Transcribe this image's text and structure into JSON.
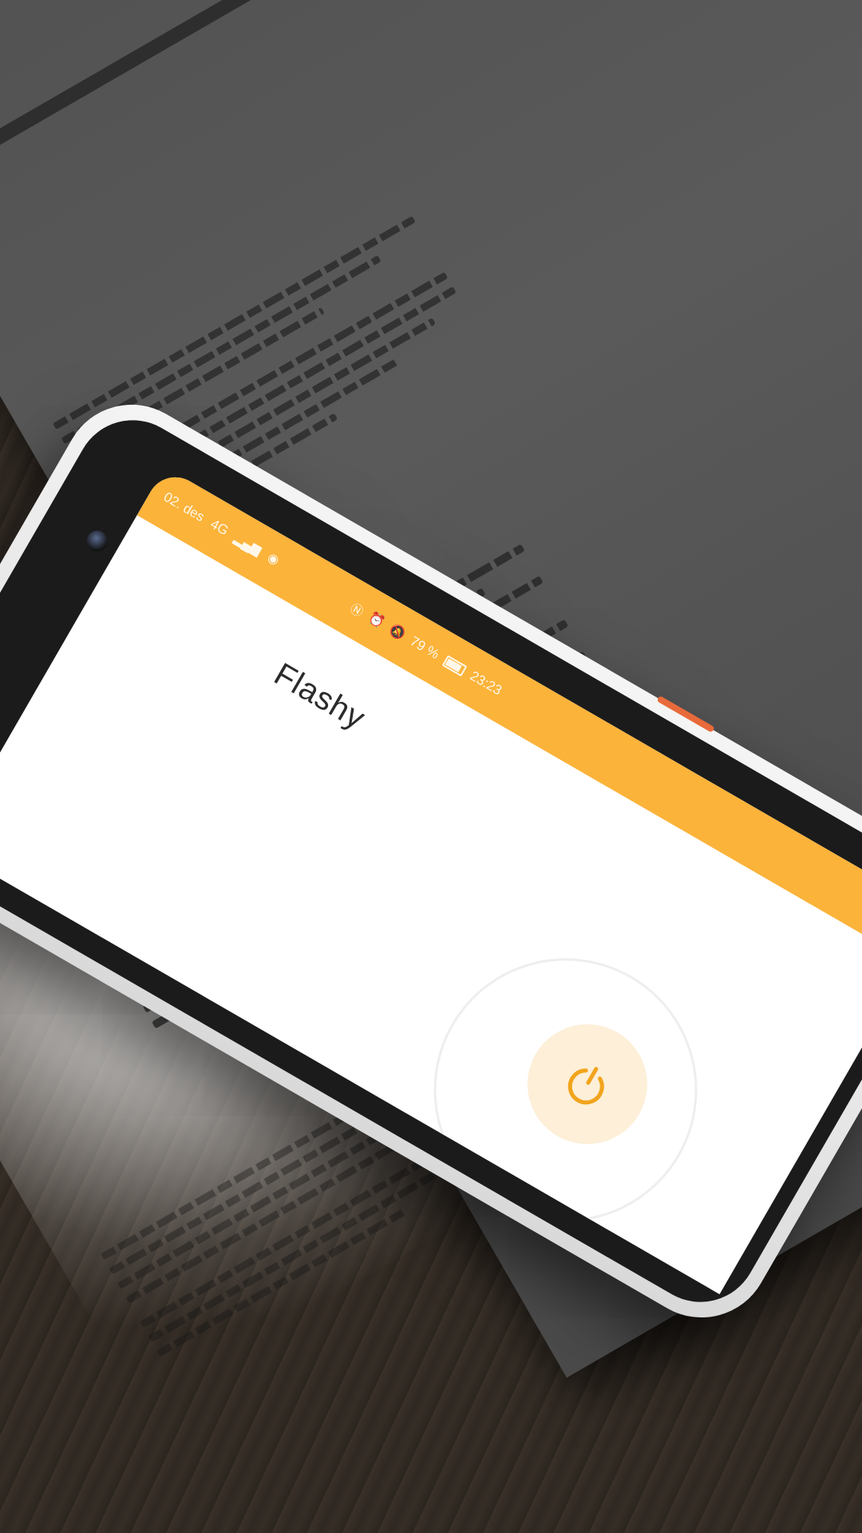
{
  "status_bar": {
    "date": "02. des",
    "network": "4G",
    "battery": "79 %",
    "battery_level": 0.79,
    "time": "23:23"
  },
  "app": {
    "title": "Flashy"
  },
  "flashlight": {
    "power_icon": "power-icon"
  },
  "colors": {
    "accent": "#fbb33a",
    "power_bg": "#fdefd8",
    "power_icon": "#f2a41c"
  }
}
